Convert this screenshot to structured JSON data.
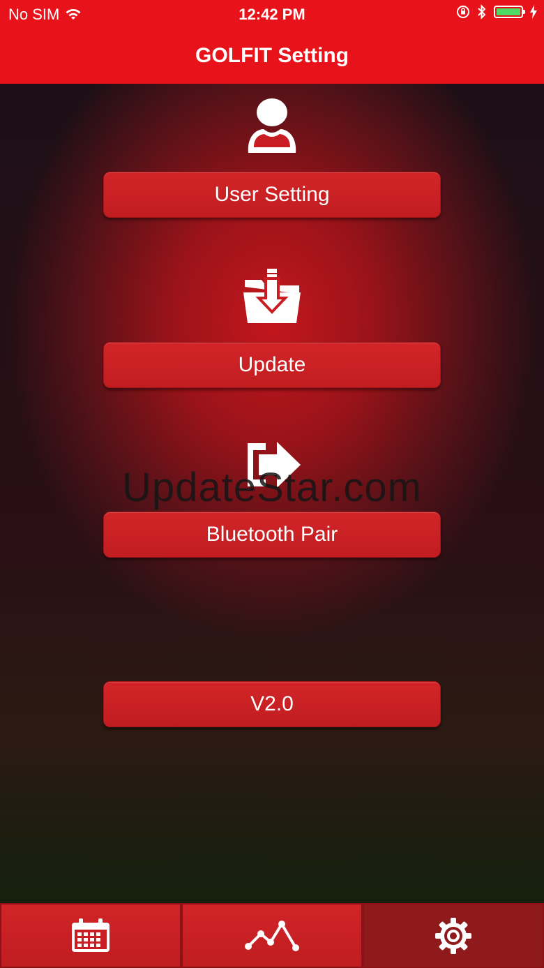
{
  "status_bar": {
    "carrier": "No SIM",
    "time": "12:42 PM"
  },
  "header": {
    "title": "GOLFIT Setting"
  },
  "menu": {
    "user_setting_label": "User Setting",
    "update_label": "Update",
    "bluetooth_pair_label": "Bluetooth Pair",
    "version_label": "V2.0"
  },
  "watermark": "UpdateStar.com",
  "tab_bar": {
    "tabs": [
      {
        "icon": "calendar-icon",
        "active": false
      },
      {
        "icon": "chart-line-icon",
        "active": false
      },
      {
        "icon": "gear-icon",
        "active": true
      }
    ]
  },
  "colors": {
    "accent": "#e8131a",
    "button": "#c91f23",
    "active_tab": "#8e1a1c"
  }
}
